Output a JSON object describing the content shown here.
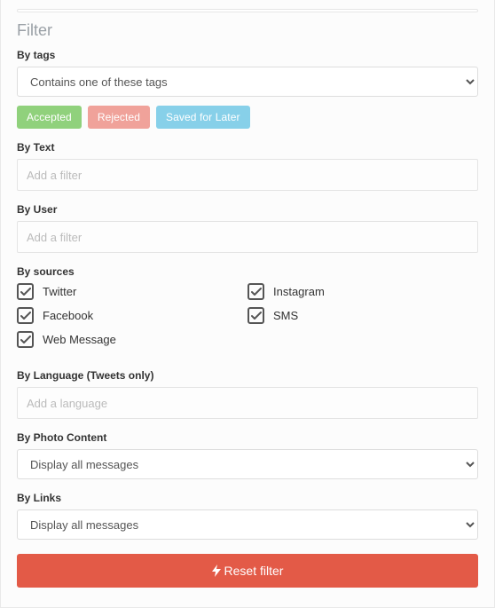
{
  "filter": {
    "title": "Filter",
    "tags": {
      "label": "By tags",
      "select_value": "Contains one of these tags",
      "pills": {
        "accepted": "Accepted",
        "rejected": "Rejected",
        "saved": "Saved for Later"
      }
    },
    "by_text": {
      "label": "By Text",
      "placeholder": "Add a filter"
    },
    "by_user": {
      "label": "By User",
      "placeholder": "Add a filter"
    },
    "by_sources": {
      "label": "By sources",
      "items": [
        {
          "label": "Twitter",
          "checked": true
        },
        {
          "label": "Instagram",
          "checked": true
        },
        {
          "label": "Facebook",
          "checked": true
        },
        {
          "label": "SMS",
          "checked": true
        },
        {
          "label": "Web Message",
          "checked": true
        }
      ]
    },
    "by_language": {
      "label": "By Language (Tweets only)",
      "placeholder": "Add a language"
    },
    "by_photo": {
      "label": "By Photo Content",
      "select_value": "Display all messages"
    },
    "by_links": {
      "label": "By Links",
      "select_value": "Display all messages"
    },
    "reset_label": "Reset filter"
  }
}
